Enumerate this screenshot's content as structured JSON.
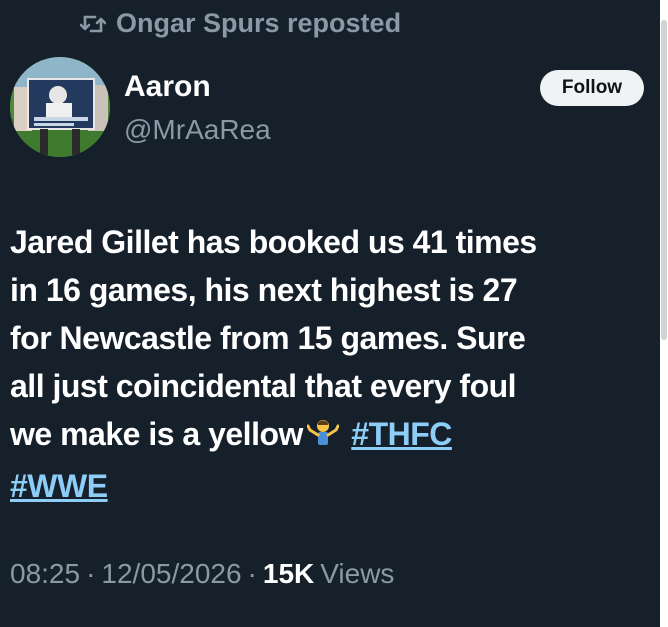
{
  "repost": {
    "text": "Ongar Spurs reposted",
    "icon": "repost-icon"
  },
  "author": {
    "name": "Aaron",
    "handle": "@MrAaRea",
    "avatar_icon": "avatar"
  },
  "follow_button": {
    "label": "Follow"
  },
  "tweet": {
    "line1": "Jared Gillet has booked us 41 times",
    "line2": "in 16 games, his next highest is 27",
    "line3": "for Newcastle from 15 games. Sure",
    "line4": "all just coincidental that every foul",
    "line5": "we make is a yellow",
    "emoji": "person-shrugging-emoji",
    "hashtag1": "#THFC",
    "hashtag2": "#WWE"
  },
  "meta": {
    "time": "08:25",
    "separator1": "·",
    "date": "12/05/2026",
    "separator2": "·",
    "views_count": "15K",
    "views_label": "Views"
  },
  "colors": {
    "background": "#15202b",
    "muted_text": "#8b98a5",
    "link": "#8ecdf8",
    "follow_bg": "#eff3f4"
  }
}
